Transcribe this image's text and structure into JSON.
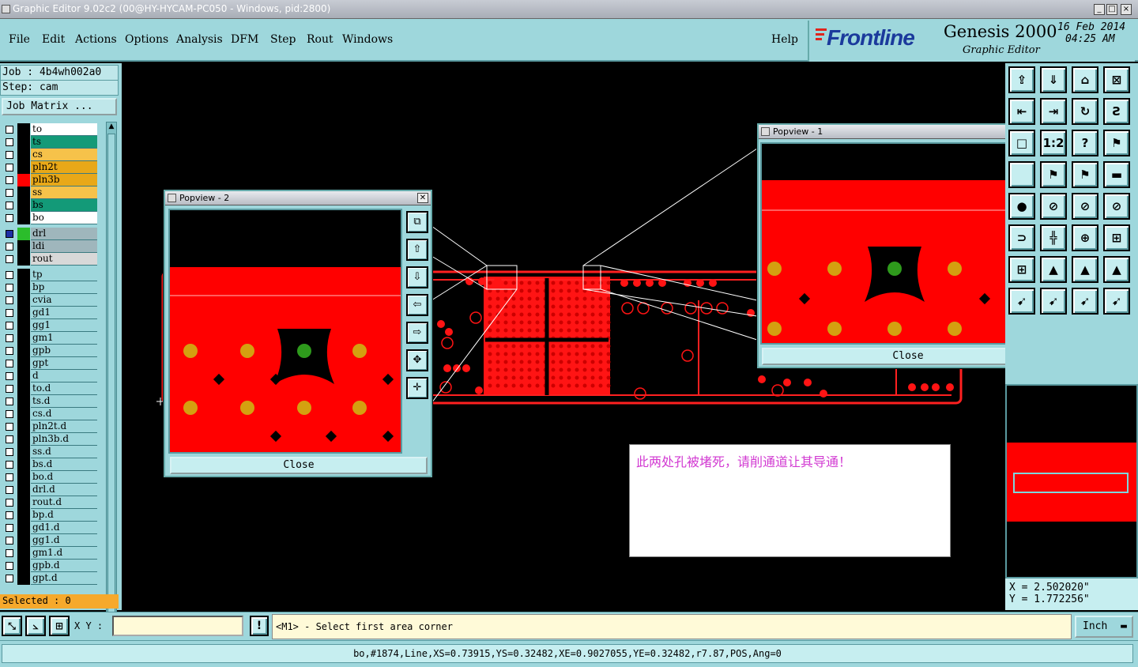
{
  "window": {
    "title": "Graphic Editor 9.02c2 (00@HY-HYCAM-PC050 - Windows, pid:2800)",
    "controls": [
      "_",
      "□",
      "×"
    ]
  },
  "menu": {
    "items": [
      "File",
      "Edit",
      "Actions",
      "Options",
      "Analysis",
      "DFM",
      "Step",
      "Rout",
      "Windows"
    ],
    "help": "Help"
  },
  "brand": {
    "logo": "Frontline",
    "product": "Genesis 2000",
    "subtitle": "Graphic Editor",
    "date": "16 Feb 2014",
    "time": "04:25 AM"
  },
  "job": {
    "job_line": "Job : 4b4wh002a0",
    "step_line": "Step: cam",
    "matrix_button": "Job Matrix ..."
  },
  "layers": [
    {
      "name": "to",
      "color": "#ffffff",
      "swatch": "#000000"
    },
    {
      "name": "ts",
      "color": "#139a78",
      "swatch": "#000000"
    },
    {
      "name": "cs",
      "color": "#f6c24a",
      "swatch": "#000000"
    },
    {
      "name": "pln2t",
      "color": "#e8a818",
      "swatch": "#000000"
    },
    {
      "name": "pln3b",
      "color": "#e8a818",
      "swatch": "#ff0000"
    },
    {
      "name": "ss",
      "color": "#f6c24a",
      "swatch": "#000000"
    },
    {
      "name": "bs",
      "color": "#139a78",
      "swatch": "#000000"
    },
    {
      "name": "bo",
      "color": "#ffffff",
      "swatch": "#000000"
    },
    {
      "name": "drl",
      "color": "#9fb6bc",
      "swatch": "#2bbd2b",
      "gap": true
    },
    {
      "name": "ldi",
      "color": "#9fb6bc",
      "swatch": "#000000"
    },
    {
      "name": "rout",
      "color": "#d8d8d8",
      "swatch": "#000000"
    },
    {
      "name": "tp",
      "color": "#9ed7dc",
      "swatch": "#000000",
      "gap": true
    },
    {
      "name": "bp",
      "color": "#9ed7dc",
      "swatch": "#000000"
    },
    {
      "name": "cvia",
      "color": "#9ed7dc",
      "swatch": "#000000"
    },
    {
      "name": "gd1",
      "color": "#9ed7dc",
      "swatch": "#000000"
    },
    {
      "name": "gg1",
      "color": "#9ed7dc",
      "swatch": "#000000"
    },
    {
      "name": "gm1",
      "color": "#9ed7dc",
      "swatch": "#000000"
    },
    {
      "name": "gpb",
      "color": "#9ed7dc",
      "swatch": "#000000"
    },
    {
      "name": "gpt",
      "color": "#9ed7dc",
      "swatch": "#000000"
    },
    {
      "name": "d",
      "color": "#9ed7dc",
      "swatch": "#000000"
    },
    {
      "name": "to.d",
      "color": "#9ed7dc",
      "swatch": "#000000"
    },
    {
      "name": "ts.d",
      "color": "#9ed7dc",
      "swatch": "#000000"
    },
    {
      "name": "cs.d",
      "color": "#9ed7dc",
      "swatch": "#000000"
    },
    {
      "name": "pln2t.d",
      "color": "#9ed7dc",
      "swatch": "#000000"
    },
    {
      "name": "pln3b.d",
      "color": "#9ed7dc",
      "swatch": "#000000"
    },
    {
      "name": "ss.d",
      "color": "#9ed7dc",
      "swatch": "#000000"
    },
    {
      "name": "bs.d",
      "color": "#9ed7dc",
      "swatch": "#000000"
    },
    {
      "name": "bo.d",
      "color": "#9ed7dc",
      "swatch": "#000000"
    },
    {
      "name": "drl.d",
      "color": "#9ed7dc",
      "swatch": "#000000"
    },
    {
      "name": "rout.d",
      "color": "#9ed7dc",
      "swatch": "#000000"
    },
    {
      "name": "bp.d",
      "color": "#9ed7dc",
      "swatch": "#000000"
    },
    {
      "name": "gd1.d",
      "color": "#9ed7dc",
      "swatch": "#000000"
    },
    {
      "name": "gg1.d",
      "color": "#9ed7dc",
      "swatch": "#000000"
    },
    {
      "name": "gm1.d",
      "color": "#9ed7dc",
      "swatch": "#000000"
    },
    {
      "name": "gpb.d",
      "color": "#9ed7dc",
      "swatch": "#000000"
    },
    {
      "name": "gpt.d",
      "color": "#9ed7dc",
      "swatch": "#000000"
    }
  ],
  "selected": "Selected : 0",
  "popview2": {
    "title": "Popview - 2",
    "close_label": "Close"
  },
  "popview1": {
    "title": "Popview - 1",
    "close_label": "Close"
  },
  "note": "此两处孔被堵死，请削通道让其导通！",
  "coords": {
    "x": "X = 2.502020\"",
    "y": "Y = 1.772256\""
  },
  "command": {
    "xy_label": "X Y :",
    "xy_value": "",
    "prompt": "<M1> - Select first area corner",
    "units": "Inch"
  },
  "status": "bo,#1874,Line,XS=0.73915,YS=0.32482,XE=0.9027055,YE=0.32482,r7.87,POS,Ang=0",
  "colors": {
    "panel": "#9ed7dc",
    "copper": "#ff0000",
    "pad": "#d4a010",
    "drill": "#2e9a1c",
    "accent": "#f6a92c"
  }
}
